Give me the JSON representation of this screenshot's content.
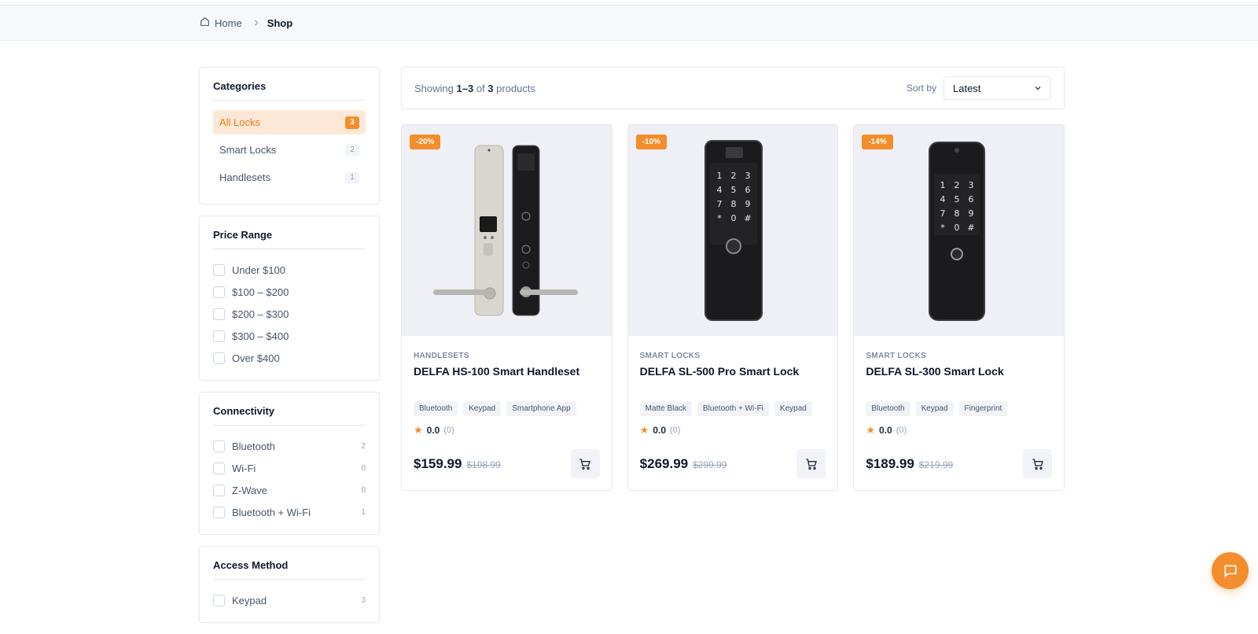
{
  "breadcrumb": {
    "home": "Home",
    "current": "Shop"
  },
  "categories": {
    "title": "Categories",
    "items": [
      {
        "label": "All Locks",
        "count": "3",
        "active": true
      },
      {
        "label": "Smart Locks",
        "count": "2",
        "active": false
      },
      {
        "label": "Handlesets",
        "count": "1",
        "active": false
      }
    ]
  },
  "price_range": {
    "title": "Price Range",
    "options": [
      "Under $100",
      "$100 – $200",
      "$200 – $300",
      "$300 – $400",
      "Over $400"
    ]
  },
  "connectivity": {
    "title": "Connectivity",
    "options": [
      {
        "label": "Bluetooth",
        "count": "2"
      },
      {
        "label": "Wi-Fi",
        "count": "0"
      },
      {
        "label": "Z-Wave",
        "count": "0"
      },
      {
        "label": "Bluetooth + Wi-Fi",
        "count": "1"
      }
    ]
  },
  "access_method": {
    "title": "Access Method",
    "options": [
      {
        "label": "Keypad",
        "count": "3"
      }
    ]
  },
  "results": {
    "showing_prefix": "Showing",
    "range": "1–3",
    "of": "of",
    "total": "3",
    "suffix": "products",
    "sort_label": "Sort by",
    "sort_value": "Latest"
  },
  "products": [
    {
      "badge": "-20%",
      "category": "HANDLESETS",
      "name": "DELFA HS-100 Smart Handleset",
      "tags": [
        "Bluetooth",
        "Keypad",
        "Smartphone App"
      ],
      "rating": "0.0",
      "reviews": "(0)",
      "price": "$159.99",
      "old_price": "$198.99"
    },
    {
      "badge": "-10%",
      "category": "SMART LOCKS",
      "name": "DELFA SL-500 Pro Smart Lock",
      "tags": [
        "Matte Black",
        "Bluetooth + Wi-Fi",
        "Keypad"
      ],
      "rating": "0.0",
      "reviews": "(0)",
      "price": "$269.99",
      "old_price": "$299.99"
    },
    {
      "badge": "-14%",
      "category": "SMART LOCKS",
      "name": "DELFA SL-300 Smart Lock",
      "tags": [
        "Bluetooth",
        "Keypad",
        "Fingerprint"
      ],
      "rating": "0.0",
      "reviews": "(0)",
      "price": "$189.99",
      "old_price": "$219.99"
    }
  ],
  "keypad_keys": [
    "1",
    "2",
    "3",
    "4",
    "5",
    "6",
    "7",
    "8",
    "9",
    "*",
    "0",
    "#"
  ],
  "colors": {
    "accent": "#f48d2b",
    "accent_bg": "#fde8d7",
    "text": "#0f172a",
    "muted": "#94a3b8"
  }
}
